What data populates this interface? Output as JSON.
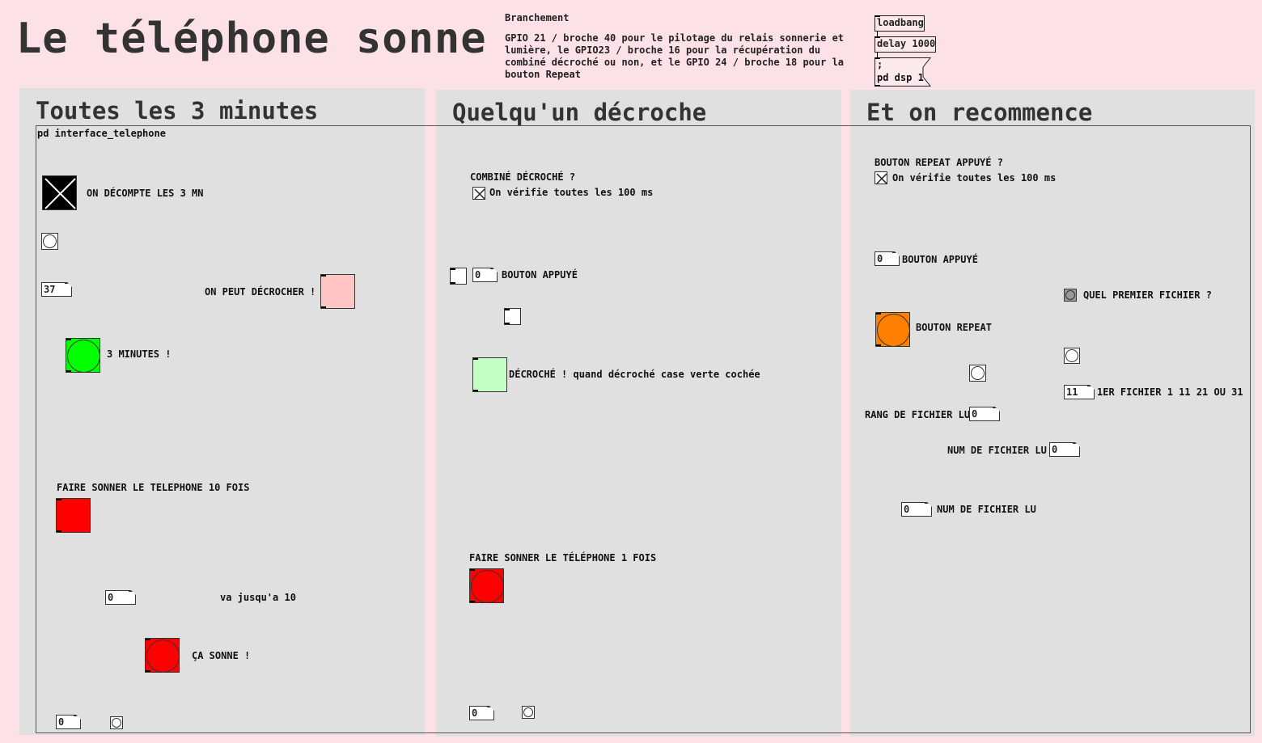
{
  "header": {
    "title": "Le téléphone sonne",
    "branchement_heading": "Branchement",
    "branchement_lines": [
      "GPIO 21 / broche 40 pour le pilotage du relais sonnerie et",
      "lumière, le GPIO23 / broche 16 pour la récupération du",
      "combiné décroché ou non, et le GPIO 24 / broche 18 pour la",
      "bouton Repeat"
    ],
    "objects": {
      "loadbang": "loadbang",
      "delay": "delay 1000",
      "msg_line1": ";",
      "msg_line2": "pd dsp 1"
    }
  },
  "subpatch_label": "pd interface_telephone",
  "panels": {
    "left": {
      "title": "Toutes les 3 minutes",
      "labels": {
        "countdown": "ON DÉCOMPTE LES 3 MN",
        "can_pickup": "ON PEUT DÉCROCHER !",
        "three_min": "3 MINUTES !",
        "ring10": "FAIRE SONNER LE TELEPHONE 10 FOIS",
        "upto10": "va jusqu'a 10",
        "ringing": "ÇA SONNE !"
      },
      "numbers": {
        "minutes": "37",
        "counter": "0",
        "bottom": "0"
      }
    },
    "middle": {
      "title": "Quelqu'un décroche",
      "labels": {
        "handset_question": "COMBINÉ DÉCROCHÉ ?",
        "check100": "On vérifie toutes les 100 ms",
        "button_pressed": "BOUTON APPUYÉ",
        "picked_up": "DÉCROCHÉ ! quand décroché case verte cochée",
        "ring1": "FAIRE SONNER LE TÉLÉPHONE 1 FOIS"
      },
      "numbers": {
        "button": "0",
        "bottom": "0"
      }
    },
    "right": {
      "title": "Et on recommence",
      "labels": {
        "repeat_question": "BOUTON REPEAT APPUYÉ ?",
        "check100": "On vérifie toutes les 100 ms",
        "button_pressed": "BOUTON APPUYÉ",
        "first_file_q": "QUEL PREMIER FICHIER ?",
        "repeat_button": "BOUTON REPEAT",
        "first_file_options": "1ER FICHIER 1 11 21 OU 31",
        "rank_read": "RANG DE FICHIER LU",
        "num_read": "NUM DE FICHIER LU",
        "num_read2": "NUM DE FICHIER LU"
      },
      "numbers": {
        "button": "0",
        "first_file": "11",
        "rank": "0",
        "num": "0",
        "num2": "0"
      }
    }
  },
  "colors": {
    "background": "#fce1e6",
    "panel": "#e0e0e0",
    "pink_box": "#ffc4c4",
    "green": "#00ff00",
    "light_green": "#c4ffc4",
    "red": "#ff0000",
    "orange": "#ff8000"
  }
}
